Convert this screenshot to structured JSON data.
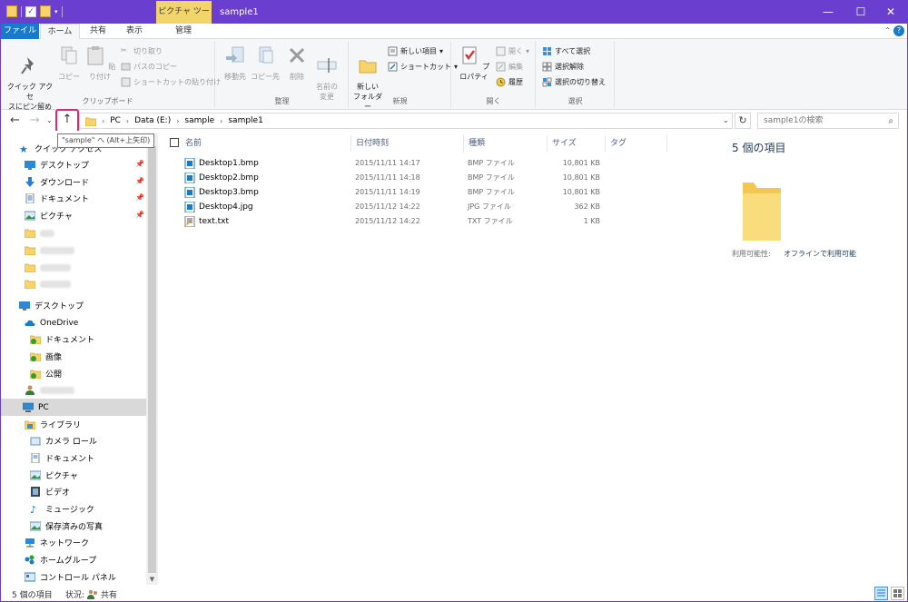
{
  "titlebar": {
    "context_tab": "ピクチャ ツール",
    "title": "sample1",
    "minimize": "—",
    "maximize": "☐",
    "close": "✕"
  },
  "ribbon_tabs": {
    "file": "ファイル",
    "home": "ホーム",
    "share": "共有",
    "view": "表示",
    "manage": "管理"
  },
  "ribbon": {
    "clipboard": {
      "label": "クリップボード",
      "pin_quick": "クイック アクセ\nスにピン留め",
      "copy": "コピー",
      "paste": "貼り付け",
      "cut": "切り取り",
      "copy_path": "パスのコピー",
      "paste_shortcut": "ショートカットの貼り付け"
    },
    "organize": {
      "label": "整理",
      "move_to": "移動先",
      "copy_to": "コピー先",
      "delete": "削除",
      "rename": "名前の\n変更"
    },
    "new": {
      "label": "新規",
      "new_folder": "新しい\nフォルダー",
      "new_item": "新しい項目",
      "shortcut": "ショートカット"
    },
    "open": {
      "label": "開く",
      "properties": "プロパティ",
      "open": "開く",
      "edit": "編集",
      "history": "履歴"
    },
    "select": {
      "label": "選択",
      "select_all": "すべて選択",
      "select_none": "選択解除",
      "invert": "選択の切り替え"
    }
  },
  "navbar": {
    "path": [
      "PC",
      "Data (E:)",
      "sample",
      "sample1"
    ],
    "search_placeholder": "sample1の検索",
    "tooltip": "\"sample\" へ (Alt+上矢印)"
  },
  "navpane": {
    "quick_access": "クイック アクセス",
    "pinned": [
      {
        "label": "デスクトップ",
        "icon": "desktop-icon"
      },
      {
        "label": "ダウンロード",
        "icon": "download-icon"
      },
      {
        "label": "ドキュメント",
        "icon": "document-icon"
      },
      {
        "label": "ピクチャ",
        "icon": "picture-icon"
      }
    ],
    "desktop": "デスクトップ",
    "onedrive": "OneDrive",
    "onedrive_items": [
      "ドキュメント",
      "画像",
      "公開"
    ],
    "pc": "PC",
    "libraries": "ライブラリ",
    "library_items": [
      "カメラ ロール",
      "ドキュメント",
      "ピクチャ",
      "ビデオ",
      "ミュージック",
      "保存済みの写真"
    ],
    "network": "ネットワーク",
    "homegroup": "ホームグループ",
    "control_panel": "コントロール パネル"
  },
  "filelist": {
    "headers": {
      "name": "名前",
      "date": "日付時刻",
      "type": "種類",
      "size": "サイズ",
      "tag": "タグ"
    },
    "rows": [
      {
        "name": "Desktop1.bmp",
        "date": "2015/11/11 14:17",
        "type": "BMP ファイル",
        "size": "10,801 KB"
      },
      {
        "name": "Desktop2.bmp",
        "date": "2015/11/11 14:18",
        "type": "BMP ファイル",
        "size": "10,801 KB"
      },
      {
        "name": "Desktop3.bmp",
        "date": "2015/11/11 14:19",
        "type": "BMP ファイル",
        "size": "10,801 KB"
      },
      {
        "name": "Desktop4.jpg",
        "date": "2015/11/12 14:22",
        "type": "JPG ファイル",
        "size": "362 KB"
      },
      {
        "name": "text.txt",
        "date": "2015/11/12 14:22",
        "type": "TXT ファイル",
        "size": "1 KB"
      }
    ]
  },
  "details": {
    "title": "5 個の項目",
    "availability_label": "利用可能性:",
    "availability_value": "オフラインで利用可能"
  },
  "statusbar": {
    "count": "5 個の項目",
    "state_label": "状況:",
    "state_value": "共有"
  },
  "colors": {
    "titlebar": "#6a3fd0",
    "file_tab": "#1979ca",
    "context_tab": "#f2d56a",
    "highlight": "#e0266e"
  }
}
